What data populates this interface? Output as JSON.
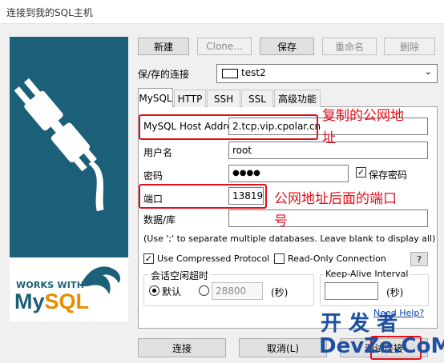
{
  "window": {
    "title": "连接到我的SQL主机"
  },
  "brand": {
    "works_with": "WORKS WITH",
    "logo_my": "My",
    "logo_sql": "SQL"
  },
  "toolbar": {
    "new": "新建",
    "clone": "Clone...",
    "save": "保存",
    "rename": "重命名",
    "delete": "删除"
  },
  "saved": {
    "label": "保/存的连接",
    "value": "test2"
  },
  "tabs": [
    "MySQL",
    "HTTP",
    "SSH",
    "SSL",
    "高级功能"
  ],
  "form": {
    "host_label": "MySQL Host Address",
    "host_value": "2.tcp.vip.cpolar.cn",
    "user_label": "用户名",
    "user_value": "root",
    "password_label": "密码",
    "password_value": "●●●●",
    "save_password": "保存密码",
    "port_label": "端口",
    "port_value": "13819",
    "db_label": "数据/库",
    "db_value": "",
    "db_hint": "(Use ';' to separate multiple databases. Leave blank to display all)",
    "compressed": "Use Compressed Protocol",
    "readonly": "Read-Only Connection",
    "help_q": "?",
    "timeout_title": "会话空闲超时",
    "default": "默认",
    "timeout_value": "28800",
    "seconds": "(秒)",
    "keepalive_title": "Keep-Alive Interval",
    "keepalive_value": "",
    "seconds2": "(秒)",
    "need_help": "Need Help?"
  },
  "annotations": {
    "copy_addr_1": "复制的公网地",
    "copy_addr_2": "址",
    "port_note_1": "公网地址后面的端口",
    "port_note_2": "号"
  },
  "footer": {
    "connect": "连接",
    "cancel": "取消(L)",
    "test": "测试连接"
  },
  "watermark": {
    "line1": "开 发 者",
    "line2": "DevZe.CoM"
  },
  "colors": {
    "accent_red": "#e0101a",
    "brand_teal": "#1b5f78"
  },
  "checks": {
    "compressed": true,
    "readonly": false,
    "save_password": true
  }
}
